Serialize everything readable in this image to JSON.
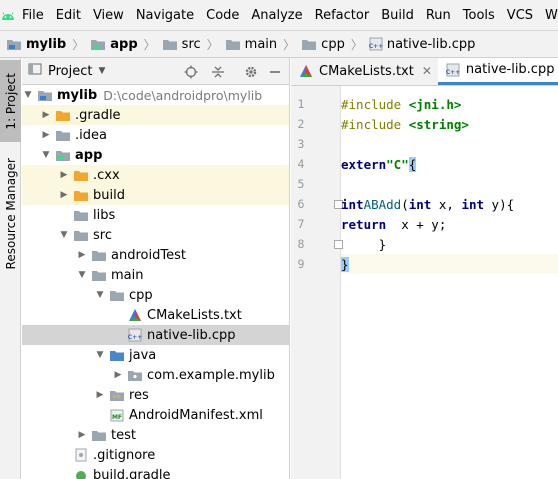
{
  "menu": {
    "items": [
      "File",
      "Edit",
      "View",
      "Navigate",
      "Code",
      "Analyze",
      "Refactor",
      "Build",
      "Run",
      "Tools",
      "VCS",
      "Window"
    ]
  },
  "breadcrumb": {
    "items": [
      "mylib",
      "app",
      "src",
      "main",
      "cpp",
      "native-lib.cpp"
    ]
  },
  "stripe": {
    "project_tab": "1: Project",
    "resource_tab": "Resource Manager"
  },
  "project_panel": {
    "title": "Project",
    "rows": [
      {
        "label": "mylib",
        "path": "D:\\code\\androidpro\\mylib"
      },
      {
        "label": ".gradle"
      },
      {
        "label": ".idea"
      },
      {
        "label": "app"
      },
      {
        "label": ".cxx"
      },
      {
        "label": "build"
      },
      {
        "label": "libs"
      },
      {
        "label": "src"
      },
      {
        "label": "androidTest"
      },
      {
        "label": "main"
      },
      {
        "label": "cpp"
      },
      {
        "label": "CMakeLists.txt"
      },
      {
        "label": "native-lib.cpp"
      },
      {
        "label": "java"
      },
      {
        "label": "com.example.mylib"
      },
      {
        "label": "res"
      },
      {
        "label": "AndroidManifest.xml"
      },
      {
        "label": "test"
      },
      {
        "label": ".gitignore"
      },
      {
        "label": "build.gradle"
      }
    ]
  },
  "editor": {
    "tabs": [
      "CMakeLists.txt",
      "native-lib.cpp"
    ],
    "line_numbers": [
      "1",
      "2",
      "3",
      "4",
      "5",
      "6",
      "7",
      "8",
      "9"
    ]
  },
  "colors": {
    "accent": "#4083c9",
    "folder": "#f0a732",
    "folder_plain": "#9aa7b0",
    "selection": "#d4d4d4",
    "highlight_row": "#fcf8df"
  }
}
